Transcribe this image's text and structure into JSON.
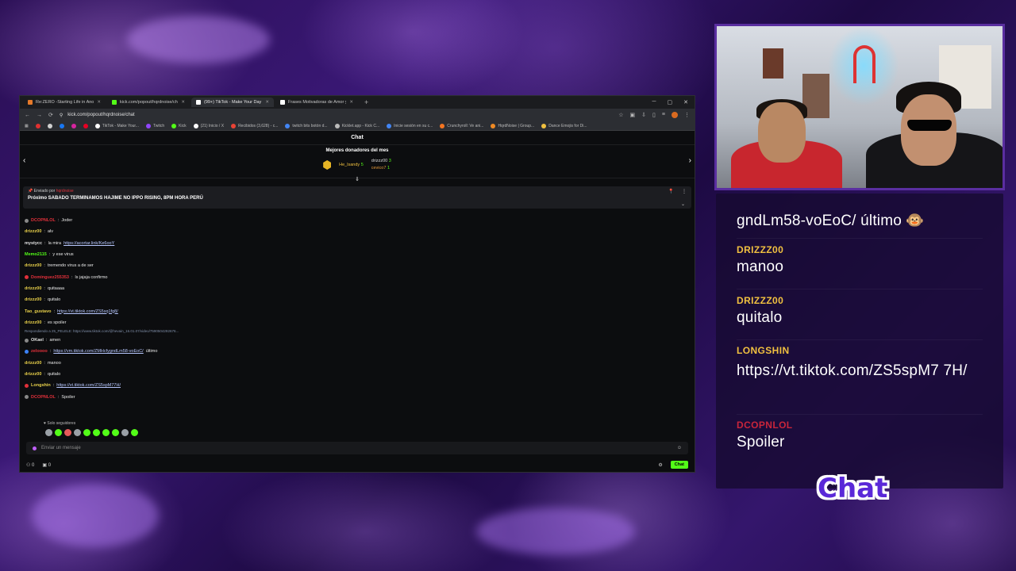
{
  "browser": {
    "tabs": [
      {
        "title": "Re:ZERO -Starting Life in Anoth",
        "color": "#e67a2a",
        "active": false
      },
      {
        "title": "kick.com/popout/hqrdnoise/ch",
        "color": "#53fc18",
        "active": false
      },
      {
        "title": "(99+) TikTok - Make Your Day",
        "color": "#ffffff",
        "active": true
      },
      {
        "title": "Frases Motivadoras de Amor y",
        "color": "#ffffff",
        "active": false
      }
    ],
    "url": "kick.com/popout/hqrdnoise/chat",
    "bookmarks": [
      "TikTok - Make Your...",
      "Twitch",
      "Kick",
      "(21) Inicio / X",
      "Recibidos (3,628) - c...",
      "twitch bits botón d...",
      "Kicklet.app - Kick C...",
      "Inicie sesión en su c...",
      "Crunchyroll: Ve ani...",
      "HqrdNoise | Group...",
      "Dance Emojis for Di..."
    ]
  },
  "chat": {
    "header": "Chat",
    "donors_title": "Mejores donadores del mes",
    "donors": [
      {
        "name": "He_lsandy",
        "count": "5"
      },
      {
        "name": "drizzz00",
        "count": "3"
      },
      {
        "name": "cevico7",
        "count": "1"
      }
    ],
    "pinned": {
      "by_label": "Enviado por",
      "by_user": "hqrdnoise",
      "text": "Próximo SABADO TERMINAMOS HAJIME NO IPPO RISING, 8PM HORA PERÚ"
    },
    "messages": [
      {
        "user": "DCOPNLOL",
        "text": "Joder",
        "link": "",
        "color": "red"
      },
      {
        "user": "drizzz00",
        "text": "alv",
        "link": "",
        "color": "yellow"
      },
      {
        "user": "mystycc",
        "text": "la mira",
        "link": "https://acortar.link/Ke6ooY",
        "color": "white"
      },
      {
        "user": "Memo2115",
        "text": "y ese virus",
        "link": "",
        "color": "green"
      },
      {
        "user": "drizzz00",
        "text": "tremendo virus a de ser",
        "link": "",
        "color": "yellow"
      },
      {
        "user": "Dominguez255353",
        "text": "ls jajaja confirmo",
        "link": "",
        "color": "red"
      },
      {
        "user": "drizzz00",
        "text": "quitaaaa",
        "link": "",
        "color": "yellow"
      },
      {
        "user": "drizzz00",
        "text": "quitalo",
        "link": "",
        "color": "yellow"
      },
      {
        "user": "Tao_gustavo",
        "text": "",
        "link": "https://vt.tiktok.com/ZS5sq1fg8/",
        "color": "yellow"
      },
      {
        "user": "drizzz00",
        "text": "es spoiler",
        "link": "",
        "color": "yellow"
      }
    ],
    "reply_hint": "Respondiendo a 25_PELELE: https://www.tiktok.com/@hevain_16.01.07/video/7590504292676...",
    "messages_2": [
      {
        "user": "OKael",
        "text": "amen",
        "link": "",
        "color": "white"
      },
      {
        "user": "zeloooo",
        "text": "último",
        "link": "https://vm.tiktok.com/ZMHcfygndLm58-voEoC/",
        "color": "red"
      },
      {
        "user": "drizzz00",
        "text": "manoo",
        "link": "",
        "color": "yellow"
      },
      {
        "user": "drizzz00",
        "text": "quitalo",
        "link": "",
        "color": "yellow"
      },
      {
        "user": "Longshin",
        "text": "",
        "link": "https://vt.tiktok.com/ZS5spM77H/",
        "color": "yellow"
      },
      {
        "user": "DCOPNLOL",
        "text": "Spoiler",
        "link": "",
        "color": "red"
      }
    ],
    "followers_only": "Solo seguidores",
    "input_placeholder": "Enviar un mensaje",
    "bottom_count": "0",
    "bottom_count_2": "0",
    "send_label": "Chat"
  },
  "overlay": {
    "messages": [
      {
        "user": "",
        "text": "gndLm58-voEoC/ último"
      },
      {
        "user": "DRIZZZ00",
        "text": "manoo"
      },
      {
        "user": "DRIZZZ00",
        "text": "quitalo"
      },
      {
        "user": "LONGSHIN",
        "text": "https://vt.tiktok.com/ZS5spM7 7H/"
      },
      {
        "user": "DCOPNLOL",
        "text": "Spoiler"
      }
    ],
    "title": "Chat"
  },
  "colors": {
    "kick_green": "#53fc18",
    "overlay_user_gold": "#f0c040",
    "overlay_user_red": "#c9253b",
    "accent_purple": "#5a28d8"
  }
}
